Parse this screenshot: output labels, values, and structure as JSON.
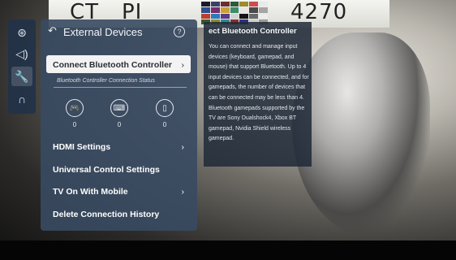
{
  "background": {
    "flag_text_left": "CT",
    "flag_text_mid": "PI",
    "flag_text_right": "4270",
    "swatch_colors": [
      "#1a1a2e",
      "#3a3f6a",
      "#6b2f2f",
      "#2d5a3a",
      "#9b8c2e",
      "#c94f4f",
      "#e9e9e9",
      "#2f4f8a",
      "#7a2d6a",
      "#c7a23a",
      "#3b8c6a",
      "#e6e6e6",
      "#4b4b4b",
      "#a5a5a5",
      "#b8402e",
      "#2e7ab8",
      "#5a3a8a",
      "#d2d2d2",
      "#141414",
      "#6a6a6a",
      "#ececec",
      "#375a2e",
      "#8a8a2e",
      "#2e8a8a",
      "#8a2e2e",
      "#2e2e8a",
      "#cfcfcf",
      "#9a9a9a"
    ]
  },
  "rail": {
    "items": [
      {
        "icon": "all-settings-icon",
        "glyph": "⊛"
      },
      {
        "icon": "sound-icon",
        "glyph": "◁)"
      },
      {
        "icon": "wrench-icon",
        "glyph": "🔧"
      },
      {
        "icon": "support-headset-icon",
        "glyph": "∩"
      }
    ]
  },
  "panel": {
    "title": "External Devices",
    "back_glyph": "↶",
    "help_glyph": "?",
    "chevron": "›",
    "connect_bt": "Connect Bluetooth Controller",
    "status_caption": "Bluetooth Controller Connection Status",
    "devices": [
      {
        "icon": "gamepad-icon",
        "glyph": "🎮",
        "count": "0"
      },
      {
        "icon": "keyboard-icon",
        "glyph": "⌨",
        "count": "0"
      },
      {
        "icon": "mouse-icon",
        "glyph": "▯",
        "count": "0"
      }
    ],
    "items": [
      {
        "label": "HDMI Settings"
      },
      {
        "label": "Universal Control Settings"
      },
      {
        "label": "TV On With Mobile"
      },
      {
        "label": "Delete Connection History"
      }
    ]
  },
  "info": {
    "title": "ect Bluetooth Controller",
    "body": "You can connect and manage input devices (keyboard, gamepad, and mouse) that support Bluetooth. Up to 4 input devices can be connected, and for gamepads, the number of devices that can be connected may be less than 4. Bluetooth gamepads supported by the TV are Sony Dualshock4, Xbox BT gamepad, Nvidia Shield wireless gamepad."
  }
}
